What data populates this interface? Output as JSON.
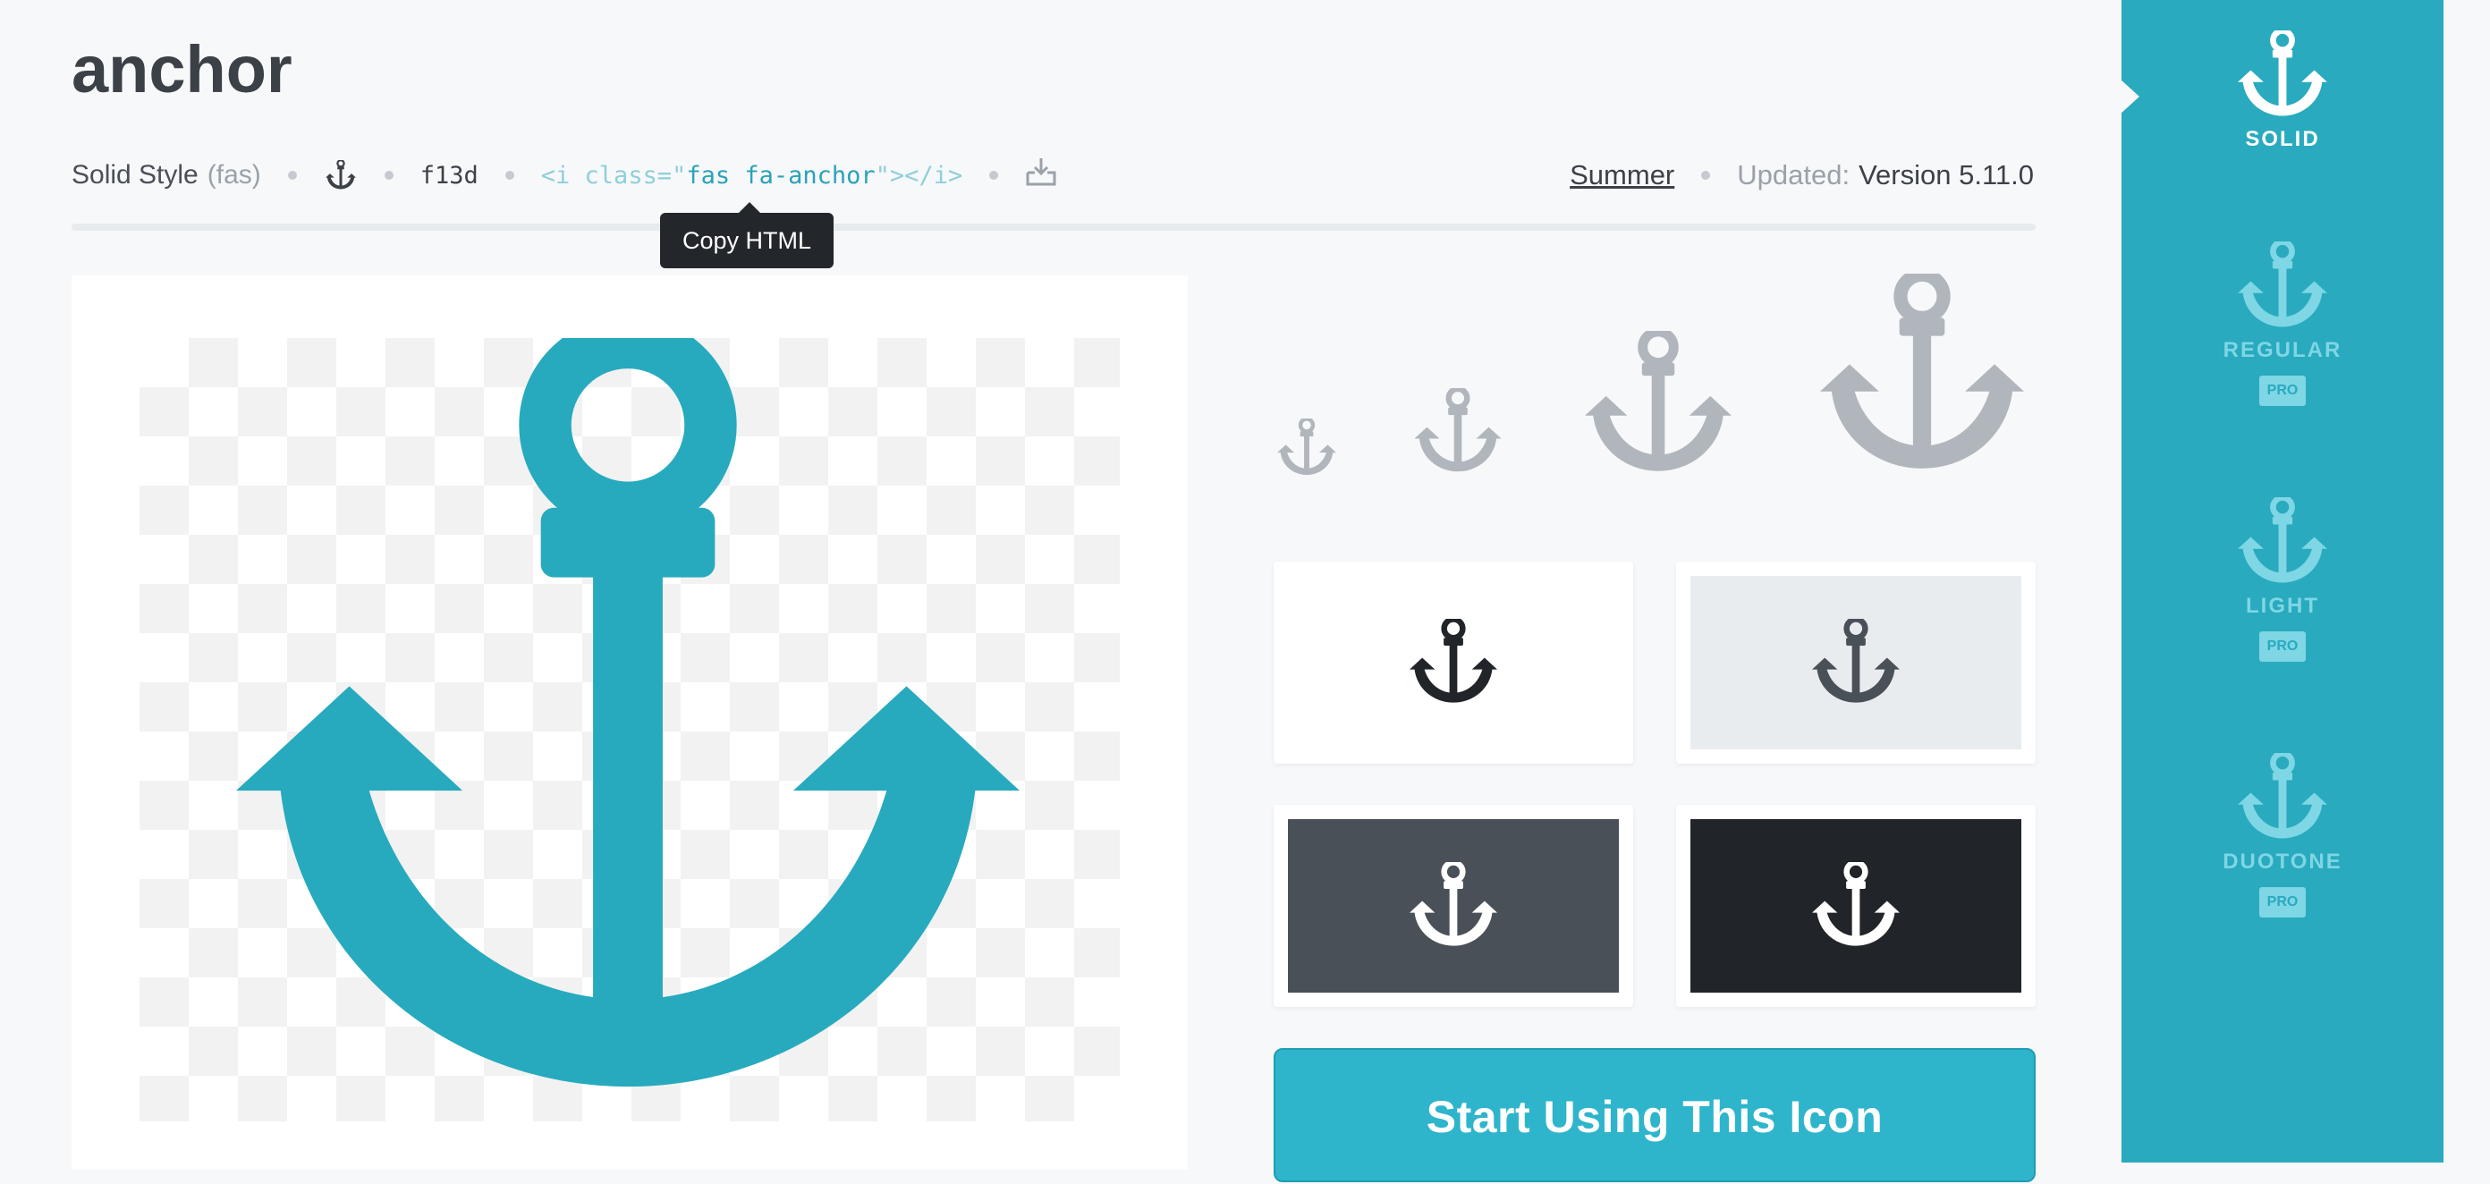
{
  "icon": {
    "name": "anchor",
    "style_label": "Solid Style",
    "style_abbr": "(fas)",
    "unicode": "f13d",
    "html_snippet": {
      "open": "<i class=\"",
      "classes": "fas fa-anchor",
      "close": "\"></i>"
    },
    "glyph_icon": "anchor-icon",
    "download_icon": "download-icon"
  },
  "meta": {
    "category_link": "Summer",
    "updated_label": "Updated:",
    "version": "Version 5.11.0"
  },
  "tooltip": {
    "text": "Copy HTML"
  },
  "cta": {
    "label": "Start Using This Icon"
  },
  "colors": {
    "brand": "#29aabe",
    "icon_primary": "#27aabe",
    "icon_muted": "#b1b6bc",
    "tile_white": "#ffffff",
    "tile_light": "#e9ecef",
    "tile_dark": "#4a5058",
    "tile_black": "#212428"
  },
  "styles": [
    {
      "label": "SOLID",
      "pro": false,
      "active": true
    },
    {
      "label": "REGULAR",
      "pro": true,
      "badge": "PRO",
      "active": false
    },
    {
      "label": "LIGHT",
      "pro": true,
      "badge": "PRO",
      "active": false
    },
    {
      "label": "DUOTONE",
      "pro": true,
      "badge": "PRO",
      "active": false
    }
  ]
}
